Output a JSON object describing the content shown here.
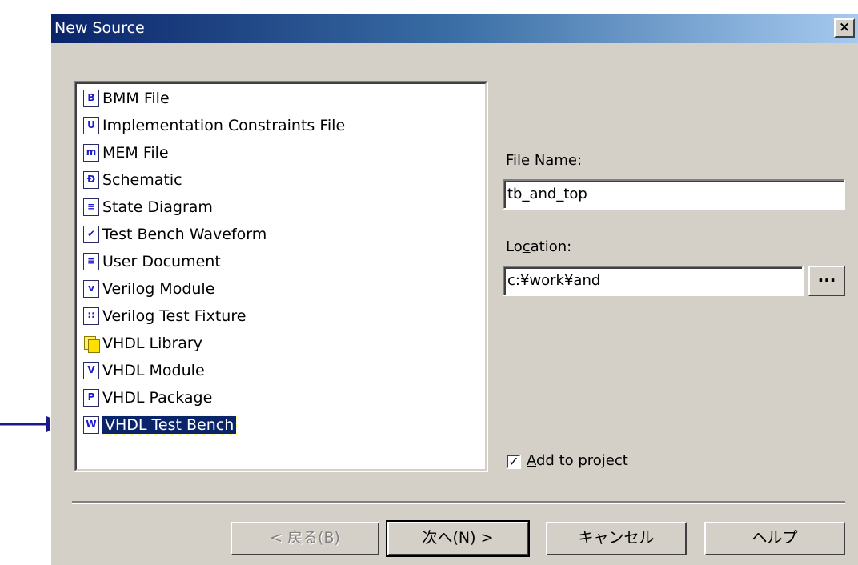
{
  "window": {
    "title": "New Source",
    "close_glyph": "×"
  },
  "source_types": [
    {
      "label": "BMM File",
      "icon": "bmm-file-icon",
      "glyph": "B"
    },
    {
      "label": "Implementation Constraints File",
      "icon": "constraints-file-icon",
      "glyph": "U"
    },
    {
      "label": "MEM File",
      "icon": "mem-file-icon",
      "glyph": "m"
    },
    {
      "label": "Schematic",
      "icon": "schematic-icon",
      "glyph": "Ð"
    },
    {
      "label": "State Diagram",
      "icon": "state-diagram-icon",
      "glyph": "≡"
    },
    {
      "label": "Test Bench Waveform",
      "icon": "test-bench-waveform-icon",
      "glyph": "✔"
    },
    {
      "label": "User Document",
      "icon": "user-document-icon",
      "glyph": "≡"
    },
    {
      "label": "Verilog Module",
      "icon": "verilog-module-icon",
      "glyph": "v"
    },
    {
      "label": "Verilog Test Fixture",
      "icon": "verilog-test-fixture-icon",
      "glyph": "∷"
    },
    {
      "label": "VHDL Library",
      "icon": "vhdl-library-icon",
      "glyph": ""
    },
    {
      "label": "VHDL Module",
      "icon": "vhdl-module-icon",
      "glyph": "V"
    },
    {
      "label": "VHDL Package",
      "icon": "vhdl-package-icon",
      "glyph": "P"
    },
    {
      "label": "VHDL Test Bench",
      "icon": "vhdl-test-bench-icon",
      "glyph": "W",
      "selected": true
    }
  ],
  "file_name": {
    "label_mnemonic": "F",
    "label_rest": "ile Name:",
    "value": "tb_and_top"
  },
  "location": {
    "label_pre": "Lo",
    "label_mnemonic": "c",
    "label_post": "ation:",
    "value": "c:¥work¥and",
    "browse_label": "..."
  },
  "add_to_project": {
    "checked": true,
    "check_glyph": "✓",
    "label_mnemonic": "A",
    "label_rest": "dd to project"
  },
  "buttons": {
    "back": "< 戻る(B)",
    "next": "次へ(N) >",
    "cancel": "キャンセル",
    "help": "ヘルプ"
  }
}
